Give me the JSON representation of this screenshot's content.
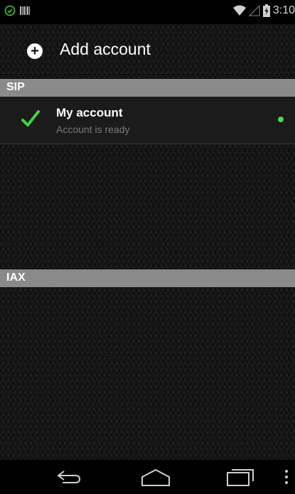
{
  "status_bar": {
    "time": "3:10",
    "left_icons": [
      "check-circle-icon",
      "barcode-icon"
    ],
    "right_icons": [
      "wifi-icon",
      "signal-icon",
      "battery-charging-icon"
    ]
  },
  "add_account": {
    "label": "Add account",
    "icon": "plus-circle-icon"
  },
  "sections": [
    {
      "title": "SIP",
      "accounts": [
        {
          "name": "My account",
          "status": "Account is ready",
          "icon": "checkmark-icon",
          "indicator_color": "#4cd84c"
        }
      ]
    },
    {
      "title": "IAX",
      "accounts": []
    }
  ],
  "nav_bar": {
    "buttons": [
      "back-icon",
      "home-icon",
      "recent-apps-icon",
      "menu-icon"
    ]
  },
  "colors": {
    "section_header_bg": "#8a8a8a",
    "check_green": "#3fd43f",
    "status_text": "#7a7a7a"
  }
}
